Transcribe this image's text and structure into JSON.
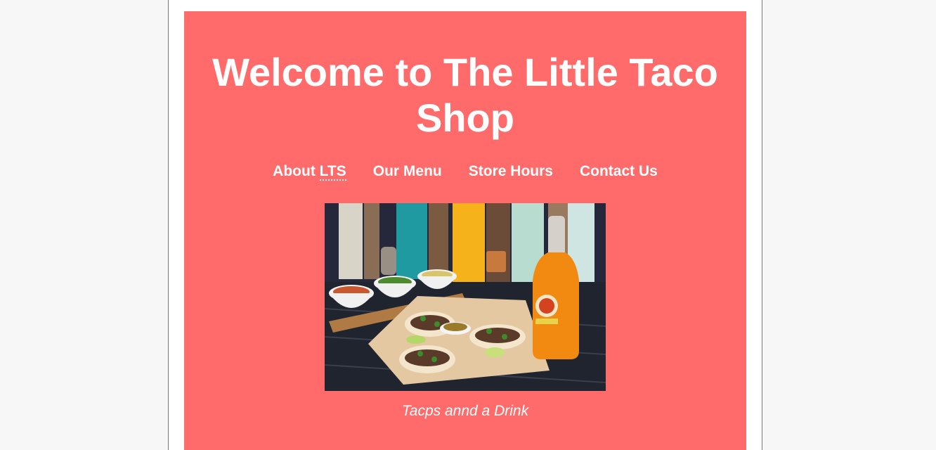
{
  "header": {
    "title": "Welcome to The Little Taco Shop"
  },
  "nav": {
    "about_prefix": "About ",
    "about_abbr": "LTS",
    "menu": "Our Menu",
    "hours": "Store Hours",
    "contact": "Contact Us"
  },
  "figure": {
    "caption": "Tacps annd a Drink"
  },
  "colors": {
    "banner": "#ff6b6b",
    "page_background": "#f7f7f7",
    "text": "#ffffff"
  }
}
